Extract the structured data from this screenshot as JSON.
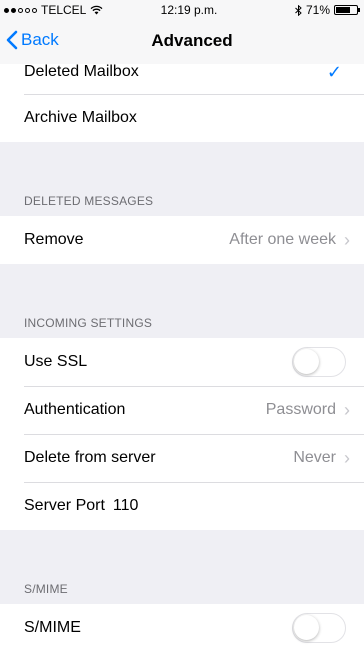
{
  "status_bar": {
    "carrier": "TELCEL",
    "wifi_icon": "wifi-icon",
    "time": "12:19 p.m.",
    "bluetooth_icon": "bluetooth-icon",
    "battery_percent": "71%",
    "battery_level": 0.71
  },
  "nav": {
    "back_label": "Back",
    "title": "Advanced"
  },
  "mailbox": {
    "deleted_label": "Deleted Mailbox",
    "archive_label": "Archive Mailbox"
  },
  "deleted_messages": {
    "header": "DELETED MESSAGES",
    "remove_label": "Remove",
    "remove_value": "After one week"
  },
  "incoming_settings": {
    "header": "INCOMING SETTINGS",
    "ssl_label": "Use SSL",
    "ssl_enabled": false,
    "auth_label": "Authentication",
    "auth_value": "Password",
    "delete_label": "Delete from server",
    "delete_value": "Never",
    "port_label": "Server Port",
    "port_value": "110"
  },
  "smime": {
    "header": "S/MIME",
    "label": "S/MIME",
    "enabled": false
  },
  "colors": {
    "accent": "#007aff",
    "background": "#efeff4",
    "secondary_text": "#8e8e93"
  }
}
